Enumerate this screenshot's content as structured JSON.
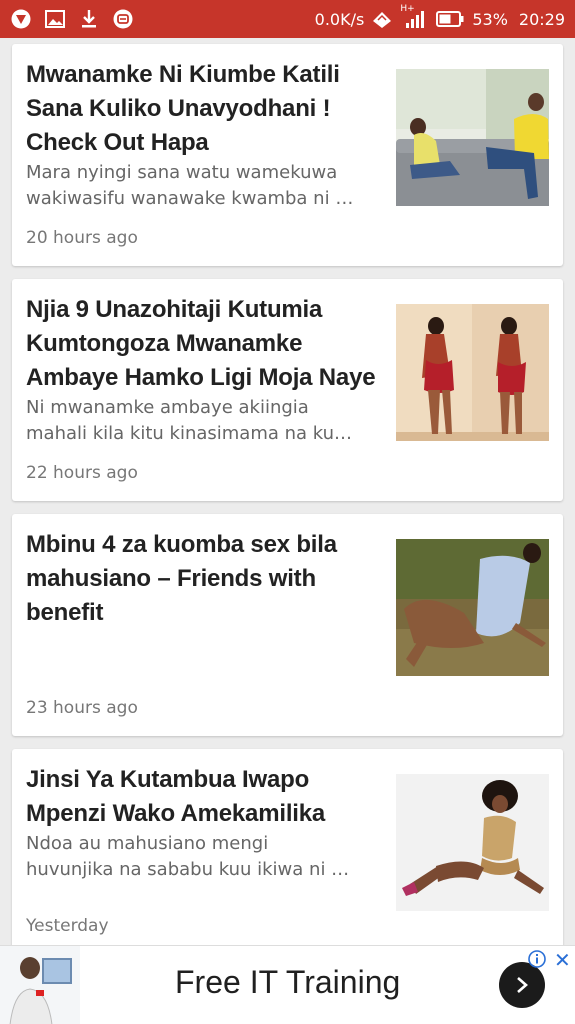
{
  "status_bar": {
    "net_speed": "0.0K/s",
    "battery": "53%",
    "time": "20:29",
    "network_type": "H+"
  },
  "articles": [
    {
      "title": "Mwanamke Ni Kiumbe Katili Sana Kuliko Unavyodhani ! Check Out Hapa",
      "excerpt_line1": "Mara nyingi sana watu wamekuwa",
      "excerpt_line2": "wakiwasifu wanawake kwamba ni …",
      "time": "20 hours ago"
    },
    {
      "title": "Njia 9 Unazohitaji Kutumia Kumtongoza Mwanamke Ambaye Hamko Ligi Moja Naye",
      "excerpt_line1": "Ni mwanamke ambaye akiingia",
      "excerpt_line2": "mahali kila kitu kinasimama na ku…",
      "time": "22 hours ago"
    },
    {
      "title": "Mbinu 4 za kuomba sex bila mahusiano – Friends with benefit",
      "excerpt_line1": "",
      "excerpt_line2": "",
      "time": "23 hours ago"
    },
    {
      "title": "Jinsi Ya Kutambua Iwapo Mpenzi Wako Amekamilika",
      "excerpt_line1": "Ndoa au mahusiano mengi",
      "excerpt_line2": "huvunjika na sababu kuu ikiwa ni …",
      "time": "Yesterday"
    }
  ],
  "ad": {
    "text": "Free IT Training"
  },
  "colors": {
    "status_bar": "#c6352a",
    "background": "#ececec",
    "title": "#222222",
    "excerpt": "#666666",
    "ad_info": "#2a6fd6"
  }
}
